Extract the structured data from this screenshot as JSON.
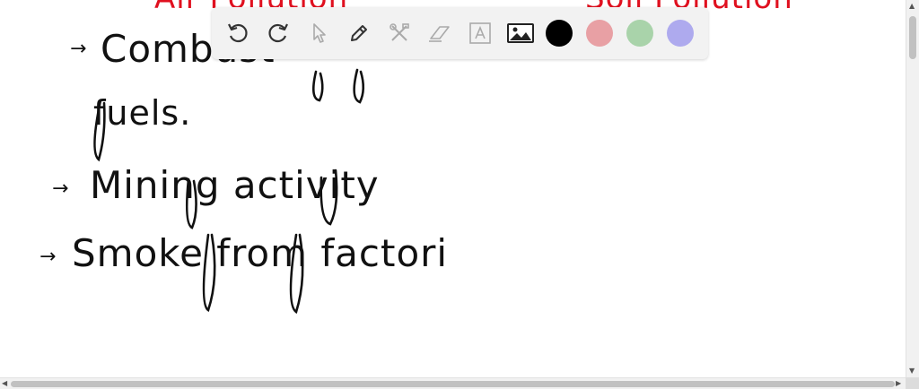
{
  "canvas": {
    "header_left": "Air Pollution",
    "header_right": "Soil Pollution",
    "lines": [
      {
        "arrow": "→",
        "text": "Combust"
      },
      {
        "arrow": "",
        "text": "fuels."
      },
      {
        "arrow": "→",
        "text": "Mining activity"
      },
      {
        "arrow": "→",
        "text": "Smoke from factori"
      }
    ]
  },
  "toolbar": {
    "tools": [
      {
        "name": "undo-button",
        "icon": "undo-icon"
      },
      {
        "name": "redo-button",
        "icon": "redo-icon"
      },
      {
        "name": "select-button",
        "icon": "pointer-icon"
      },
      {
        "name": "pen-button",
        "icon": "pencil-icon"
      },
      {
        "name": "tools-button",
        "icon": "wrench-cross-icon"
      },
      {
        "name": "eraser-button",
        "icon": "eraser-icon"
      },
      {
        "name": "text-button",
        "icon": "text-box-icon"
      },
      {
        "name": "image-button",
        "icon": "image-icon"
      }
    ],
    "colors": [
      "#000000",
      "#e8a0a4",
      "#a9d3aa",
      "#aeaaee"
    ]
  }
}
